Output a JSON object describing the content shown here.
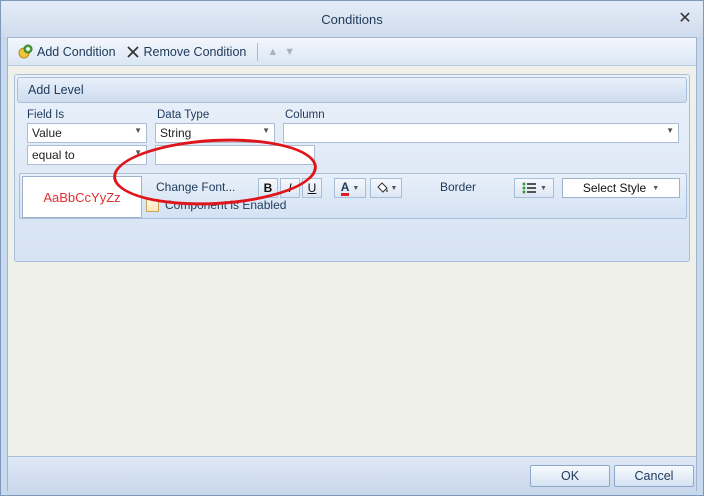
{
  "window": {
    "title": "Conditions",
    "close_label": "✕"
  },
  "toolbar": {
    "add_condition": "Add Condition",
    "remove_condition": "Remove Condition"
  },
  "level": {
    "header": "Add Level"
  },
  "fields": {
    "field_is_label": "Field Is",
    "data_type_label": "Data Type",
    "column_label": "Column",
    "field_is_value": "Value",
    "data_type_value": "String",
    "column_value": "",
    "operator_value": "equal to",
    "compare_value": ""
  },
  "format": {
    "preview_text": "AaBbCcYyZz",
    "change_font": "Change Font...",
    "bold": "B",
    "italic": "I",
    "underline": "U",
    "font_color_glyph": "A",
    "border_label": "Border",
    "select_style": "Select Style",
    "component_enabled_label": "Component is Enabled",
    "component_enabled_checked": false
  },
  "footer": {
    "ok": "OK",
    "cancel": "Cancel"
  },
  "colors": {
    "preview_text": "#e03030",
    "annotation": "#e0151b",
    "font_color_bar": "#e02020"
  }
}
